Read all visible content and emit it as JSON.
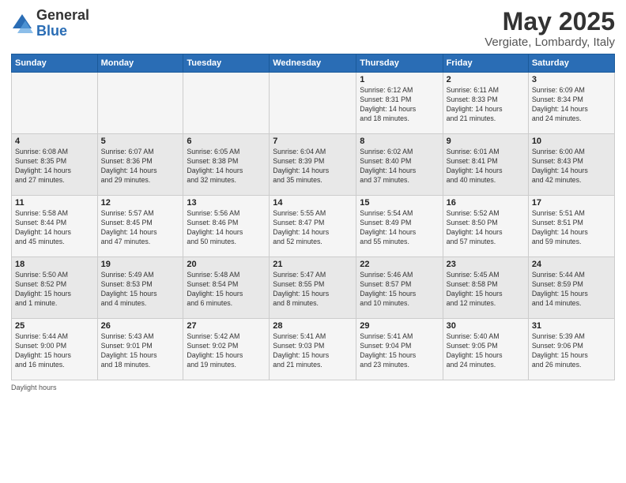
{
  "logo": {
    "general": "General",
    "blue": "Blue"
  },
  "title": "May 2025",
  "subtitle": "Vergiate, Lombardy, Italy",
  "days_of_week": [
    "Sunday",
    "Monday",
    "Tuesday",
    "Wednesday",
    "Thursday",
    "Friday",
    "Saturday"
  ],
  "weeks": [
    [
      {
        "day": "",
        "info": ""
      },
      {
        "day": "",
        "info": ""
      },
      {
        "day": "",
        "info": ""
      },
      {
        "day": "",
        "info": ""
      },
      {
        "day": "1",
        "info": "Sunrise: 6:12 AM\nSunset: 8:31 PM\nDaylight: 14 hours\nand 18 minutes."
      },
      {
        "day": "2",
        "info": "Sunrise: 6:11 AM\nSunset: 8:33 PM\nDaylight: 14 hours\nand 21 minutes."
      },
      {
        "day": "3",
        "info": "Sunrise: 6:09 AM\nSunset: 8:34 PM\nDaylight: 14 hours\nand 24 minutes."
      }
    ],
    [
      {
        "day": "4",
        "info": "Sunrise: 6:08 AM\nSunset: 8:35 PM\nDaylight: 14 hours\nand 27 minutes."
      },
      {
        "day": "5",
        "info": "Sunrise: 6:07 AM\nSunset: 8:36 PM\nDaylight: 14 hours\nand 29 minutes."
      },
      {
        "day": "6",
        "info": "Sunrise: 6:05 AM\nSunset: 8:38 PM\nDaylight: 14 hours\nand 32 minutes."
      },
      {
        "day": "7",
        "info": "Sunrise: 6:04 AM\nSunset: 8:39 PM\nDaylight: 14 hours\nand 35 minutes."
      },
      {
        "day": "8",
        "info": "Sunrise: 6:02 AM\nSunset: 8:40 PM\nDaylight: 14 hours\nand 37 minutes."
      },
      {
        "day": "9",
        "info": "Sunrise: 6:01 AM\nSunset: 8:41 PM\nDaylight: 14 hours\nand 40 minutes."
      },
      {
        "day": "10",
        "info": "Sunrise: 6:00 AM\nSunset: 8:43 PM\nDaylight: 14 hours\nand 42 minutes."
      }
    ],
    [
      {
        "day": "11",
        "info": "Sunrise: 5:58 AM\nSunset: 8:44 PM\nDaylight: 14 hours\nand 45 minutes."
      },
      {
        "day": "12",
        "info": "Sunrise: 5:57 AM\nSunset: 8:45 PM\nDaylight: 14 hours\nand 47 minutes."
      },
      {
        "day": "13",
        "info": "Sunrise: 5:56 AM\nSunset: 8:46 PM\nDaylight: 14 hours\nand 50 minutes."
      },
      {
        "day": "14",
        "info": "Sunrise: 5:55 AM\nSunset: 8:47 PM\nDaylight: 14 hours\nand 52 minutes."
      },
      {
        "day": "15",
        "info": "Sunrise: 5:54 AM\nSunset: 8:49 PM\nDaylight: 14 hours\nand 55 minutes."
      },
      {
        "day": "16",
        "info": "Sunrise: 5:52 AM\nSunset: 8:50 PM\nDaylight: 14 hours\nand 57 minutes."
      },
      {
        "day": "17",
        "info": "Sunrise: 5:51 AM\nSunset: 8:51 PM\nDaylight: 14 hours\nand 59 minutes."
      }
    ],
    [
      {
        "day": "18",
        "info": "Sunrise: 5:50 AM\nSunset: 8:52 PM\nDaylight: 15 hours\nand 1 minute."
      },
      {
        "day": "19",
        "info": "Sunrise: 5:49 AM\nSunset: 8:53 PM\nDaylight: 15 hours\nand 4 minutes."
      },
      {
        "day": "20",
        "info": "Sunrise: 5:48 AM\nSunset: 8:54 PM\nDaylight: 15 hours\nand 6 minutes."
      },
      {
        "day": "21",
        "info": "Sunrise: 5:47 AM\nSunset: 8:55 PM\nDaylight: 15 hours\nand 8 minutes."
      },
      {
        "day": "22",
        "info": "Sunrise: 5:46 AM\nSunset: 8:57 PM\nDaylight: 15 hours\nand 10 minutes."
      },
      {
        "day": "23",
        "info": "Sunrise: 5:45 AM\nSunset: 8:58 PM\nDaylight: 15 hours\nand 12 minutes."
      },
      {
        "day": "24",
        "info": "Sunrise: 5:44 AM\nSunset: 8:59 PM\nDaylight: 15 hours\nand 14 minutes."
      }
    ],
    [
      {
        "day": "25",
        "info": "Sunrise: 5:44 AM\nSunset: 9:00 PM\nDaylight: 15 hours\nand 16 minutes."
      },
      {
        "day": "26",
        "info": "Sunrise: 5:43 AM\nSunset: 9:01 PM\nDaylight: 15 hours\nand 18 minutes."
      },
      {
        "day": "27",
        "info": "Sunrise: 5:42 AM\nSunset: 9:02 PM\nDaylight: 15 hours\nand 19 minutes."
      },
      {
        "day": "28",
        "info": "Sunrise: 5:41 AM\nSunset: 9:03 PM\nDaylight: 15 hours\nand 21 minutes."
      },
      {
        "day": "29",
        "info": "Sunrise: 5:41 AM\nSunset: 9:04 PM\nDaylight: 15 hours\nand 23 minutes."
      },
      {
        "day": "30",
        "info": "Sunrise: 5:40 AM\nSunset: 9:05 PM\nDaylight: 15 hours\nand 24 minutes."
      },
      {
        "day": "31",
        "info": "Sunrise: 5:39 AM\nSunset: 9:06 PM\nDaylight: 15 hours\nand 26 minutes."
      }
    ]
  ],
  "footer": "Daylight hours"
}
